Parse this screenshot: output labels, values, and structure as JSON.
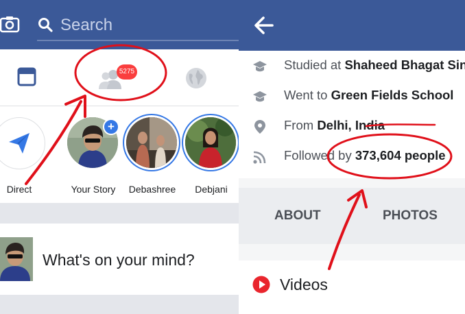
{
  "left": {
    "search": {
      "placeholder": "Search"
    },
    "tabs": {
      "friend_badge": "5275"
    },
    "stories": [
      {
        "label": "Direct"
      },
      {
        "label": "Your Story"
      },
      {
        "label": "Debashree"
      },
      {
        "label": "Debjani"
      }
    ],
    "composer": {
      "prompt": "What's on your mind?"
    }
  },
  "right": {
    "info": [
      {
        "prefix": "Studied at ",
        "bold": "Shaheed Bhagat Singh",
        "icon": "graduation-cap-icon"
      },
      {
        "prefix": "Went to ",
        "bold": "Green Fields School",
        "icon": "graduation-cap-icon"
      },
      {
        "prefix": "From ",
        "bold": "Delhi, India",
        "icon": "location-pin-icon"
      },
      {
        "prefix": "Followed by ",
        "bold": "373,604 people",
        "icon": "rss-feed-icon"
      }
    ],
    "tabs": {
      "about": "ABOUT",
      "photos": "PHOTOS"
    },
    "videos": "Videos"
  },
  "colors": {
    "brand": "#3b5998",
    "accent": "#3578e5",
    "annotation": "#e0101a",
    "badge": "#fa3e3e"
  }
}
